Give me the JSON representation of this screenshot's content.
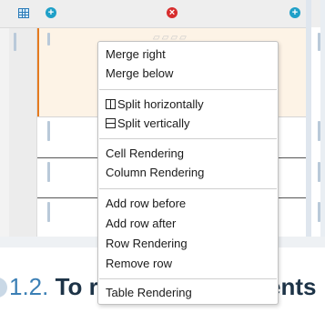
{
  "heading": {
    "number": "1.2.",
    "text": "To r",
    "tail": "ents"
  },
  "toolbar": {
    "grid_icon": "table-grid-icon",
    "add_icon": "plus-circle-icon",
    "remove_icon": "x-circle-icon",
    "add_symbol": "+",
    "remove_symbol": "×"
  },
  "colors": {
    "accent_orange": "#e57a1f",
    "add_blue": "#1fa0c8",
    "remove_red": "#d72d2d",
    "heading_blue": "#3b7fb5"
  },
  "context_menu": {
    "merge": [
      "Merge right",
      "Merge below"
    ],
    "split": [
      "Split horizontally",
      "Split vertically"
    ],
    "rendering": [
      "Cell Rendering",
      "Column Rendering"
    ],
    "rows": [
      "Add row before",
      "Add row after",
      "Row Rendering",
      "Remove row"
    ],
    "table": [
      "Table Rendering"
    ]
  }
}
